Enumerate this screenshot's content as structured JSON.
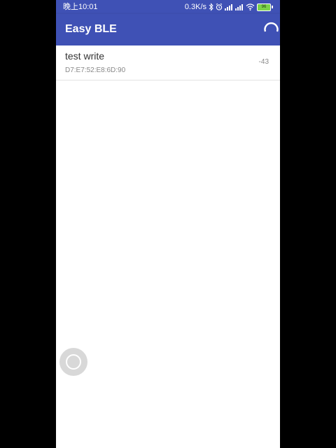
{
  "status_bar": {
    "time": "晚上10:01",
    "network_speed": "0.3K/s",
    "battery_level": "96",
    "icons": [
      "bluetooth-icon",
      "alarm-icon",
      "signal-icon",
      "signal-icon",
      "wifi-icon",
      "battery-icon"
    ],
    "color": "#3f51b5"
  },
  "app_bar": {
    "title": "Easy BLE",
    "color": "#3f51b5",
    "action_icon": "loading-spinner-icon"
  },
  "devices": [
    {
      "name": "test write",
      "address": "D7:E7:52:E8:6D:90",
      "rssi": "-43"
    }
  ],
  "floating_button": {
    "icon": "assistive-touch-icon"
  }
}
